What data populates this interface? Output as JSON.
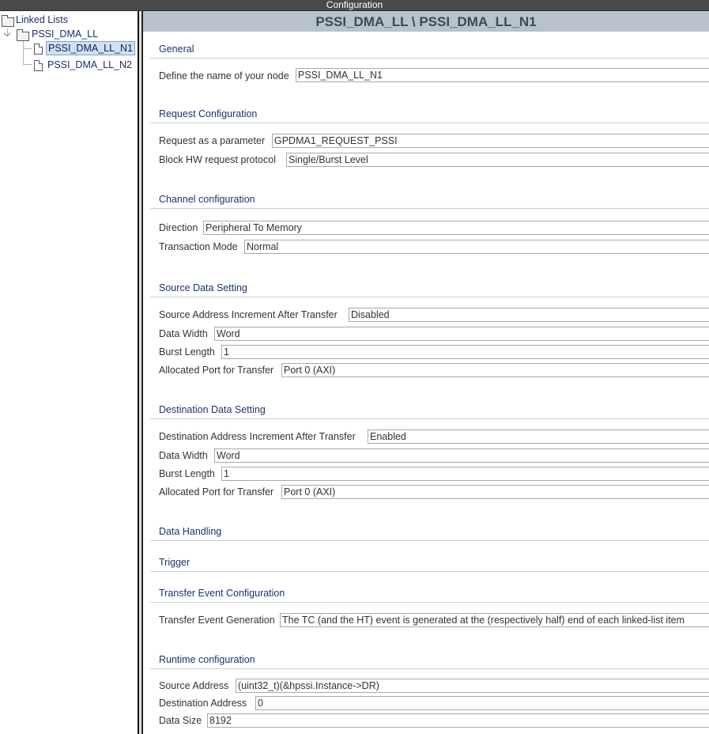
{
  "window": {
    "title": "Configuration"
  },
  "tree": {
    "root": "Linked Lists",
    "list": "PSSI_DMA_LL",
    "nodes": [
      "PSSI_DMA_LL_N1",
      "PSSI_DMA_LL_N2"
    ],
    "selected_node": "PSSI_DMA_LL_N1"
  },
  "panel": {
    "header": "PSSI_DMA_LL \\ PSSI_DMA_LL_N1"
  },
  "general": {
    "title": "General",
    "node_name_label": "Define the name of your node",
    "node_name_value": "PSSI_DMA_LL_N1"
  },
  "request": {
    "title": "Request Configuration",
    "request_label": "Request as a parameter",
    "request_value": "GPDMA1_REQUEST_PSSI",
    "block_label": "Block HW request protocol",
    "block_value": "Single/Burst Level"
  },
  "channel": {
    "title": "Channel configuration",
    "direction_label": "Direction",
    "direction_value": "Peripheral To Memory",
    "mode_label": "Transaction Mode",
    "mode_value": "Normal"
  },
  "source": {
    "title": "Source Data Setting",
    "increment_label": "Source Address Increment After Transfer",
    "increment_value": "Disabled",
    "width_label": "Data Width",
    "width_value": "Word",
    "burst_label": "Burst Length",
    "burst_value": "1",
    "port_label": "Allocated Port for Transfer",
    "port_value": "Port 0 (AXI)"
  },
  "destination": {
    "title": "Destination Data Setting",
    "increment_label": "Destination Address Increment After Transfer",
    "increment_value": "Enabled",
    "width_label": "Data Width",
    "width_value": "Word",
    "burst_label": "Burst Length",
    "burst_value": "1",
    "port_label": "Allocated Port for Transfer",
    "port_value": "Port 0 (AXI)"
  },
  "data_handling": {
    "title": "Data Handling"
  },
  "trigger": {
    "title": "Trigger"
  },
  "transfer_event": {
    "title": "Transfer Event Configuration",
    "generation_label": "Transfer Event Generation",
    "generation_value": "The TC (and the HT) event is generated at the (respectively half) end of each linked-list item"
  },
  "runtime": {
    "title": "Runtime configuration",
    "src_addr_label": "Source Address",
    "src_addr_value": "(uint32_t)(&hpssi.Instance->DR)",
    "dst_addr_label": "Destination Address",
    "dst_addr_value": "0",
    "size_label": "Data Size",
    "size_value": "8192"
  },
  "icons": [
    "folder-icon",
    "document-icon",
    "chevron-down-icon"
  ]
}
